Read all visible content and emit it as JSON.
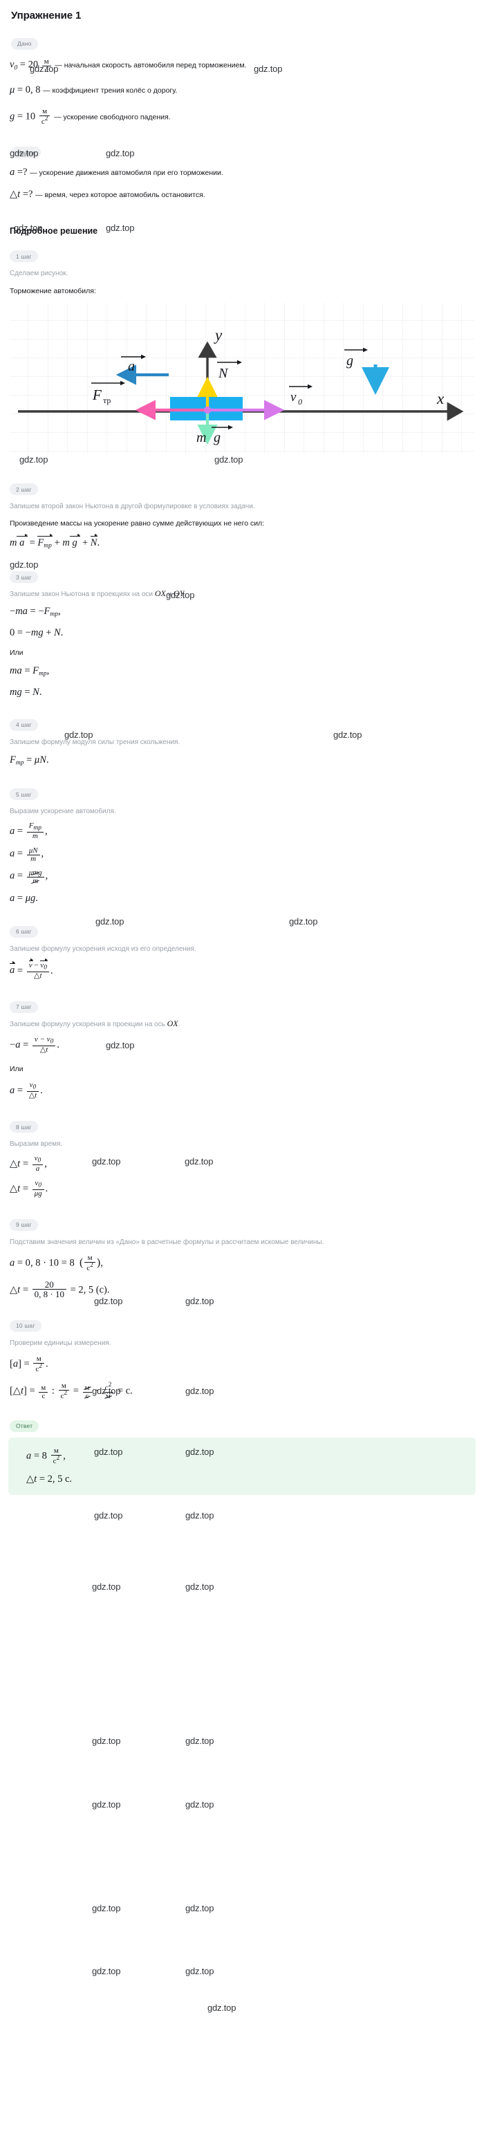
{
  "page": {
    "title": "Упражнение 1",
    "watermark_text": "gdz.top"
  },
  "given": {
    "label": "Дано",
    "items": [
      {
        "lhs": "v",
        "sub": "0",
        "eq": "= 20",
        "num": "м",
        "den": "с",
        "text": "— начальная скорость автомобиля перед торможением."
      },
      {
        "lhs": "μ",
        "sub": "",
        "eq": "= 0, 8",
        "num": "",
        "den": "",
        "text": "— коэффициент трения колёс о дорогу."
      },
      {
        "lhs": "g",
        "sub": "",
        "eq": "= 10",
        "num": "м",
        "den": "с²",
        "text": "— ускорение свободного падения."
      }
    ]
  },
  "find": {
    "label": "Найти",
    "items": [
      {
        "expr": "a =?",
        "text": "— ускорение движения автомобиля при его торможении."
      },
      {
        "expr": "△t =?",
        "text": "— время, через которое автомобиль остановится."
      }
    ]
  },
  "solution": {
    "heading": "Подробное решение",
    "steps": [
      {
        "label": "1 шаг",
        "desc": "Сделаем рисунок.",
        "subhead": "Торможение автомобиля:",
        "figure": {
          "axis_x_label": "x",
          "axis_y_label": "y",
          "vectors": [
            {
              "name": "a",
              "label": "a",
              "color": "#2980b9",
              "direction": "left"
            },
            {
              "name": "N",
              "label": "N",
              "color": "#ffd700",
              "direction": "up"
            },
            {
              "name": "F_tr",
              "label": "F",
              "sub": "тр",
              "color": "#ff69b4",
              "direction": "left"
            },
            {
              "name": "v0",
              "label": "v",
              "sub": "0",
              "color": "#da70d6",
              "direction": "right"
            },
            {
              "name": "mg",
              "label": "m g",
              "color": "#7fffd4",
              "direction": "down"
            },
            {
              "name": "g",
              "label": "g",
              "color": "#29abe2",
              "direction": "down"
            }
          ],
          "body_color": "#1ab0f0"
        }
      },
      {
        "label": "2 шаг",
        "desc": "Запишем второй закон Ньютона в другой формулировке в условиях задачи.",
        "bold": "Произведение массы на ускорение равно сумме действующих не него сил:",
        "eq1": "m a = F_тр + m g + N."
      },
      {
        "label": "3 шаг",
        "desc": "Запишем закон Ньютона в проекциях на оси OX и OY.",
        "eq1": "−ma = −F_тр,",
        "eq2": "0 = −mg + N.",
        "or": "Или",
        "eq3": "ma = F_тр,",
        "eq4": "mg = N."
      },
      {
        "label": "4 шаг",
        "desc": "Запишем формулу модуля силы трения скольжения.",
        "eq1": "F_тр = μN."
      },
      {
        "label": "5 шаг",
        "desc": "Выразим ускорение автомобиля.",
        "eq1": "a = F_тр / m ,",
        "eq2": "a = μN / m ,",
        "eq3": "a = μmg / m ,",
        "eq4": "a = μg."
      },
      {
        "label": "6 шаг",
        "desc": "Запишем формулу ускорения исходя из его определения.",
        "eq1": "a = (v − v0) / △t ."
      },
      {
        "label": "7 шаг",
        "desc": "Запишем формулу ускорения в проекции на ось OX.",
        "eq1": "−a = (v − v0) / △t .",
        "or": "Или",
        "eq2": "a = v0 / △t ."
      },
      {
        "label": "8 шаг",
        "desc": "Выразим время.",
        "eq1": "△t = v0 / a ,",
        "eq2": "△t = v0 / μg ."
      },
      {
        "label": "9 шаг",
        "desc": "Подставим значения величин из «Дано» в расчетные формулы и рассчитаем искомые величины.",
        "eq1": "a = 0, 8 · 10 = 8  ( м/с² ),",
        "eq2": "△t = 20 / (0, 8 · 10) = 2, 5  (с)."
      },
      {
        "label": "10 шаг",
        "desc": "Проверим единицы измерения.",
        "eq1": "[a] = м/с² .",
        "eq2": "[△t] = м/с : м/с² = м/с · с²/м = с."
      }
    ]
  },
  "answer": {
    "label": "Ответ",
    "lines": [
      {
        "lhs": "a",
        "eq": "= 8",
        "num": "м",
        "den": "с²",
        "tail": ","
      },
      {
        "lhs": "△t",
        "eq": "= 2, 5",
        "unit": "с.",
        "num": "",
        "den": "",
        "tail": ""
      }
    ]
  }
}
